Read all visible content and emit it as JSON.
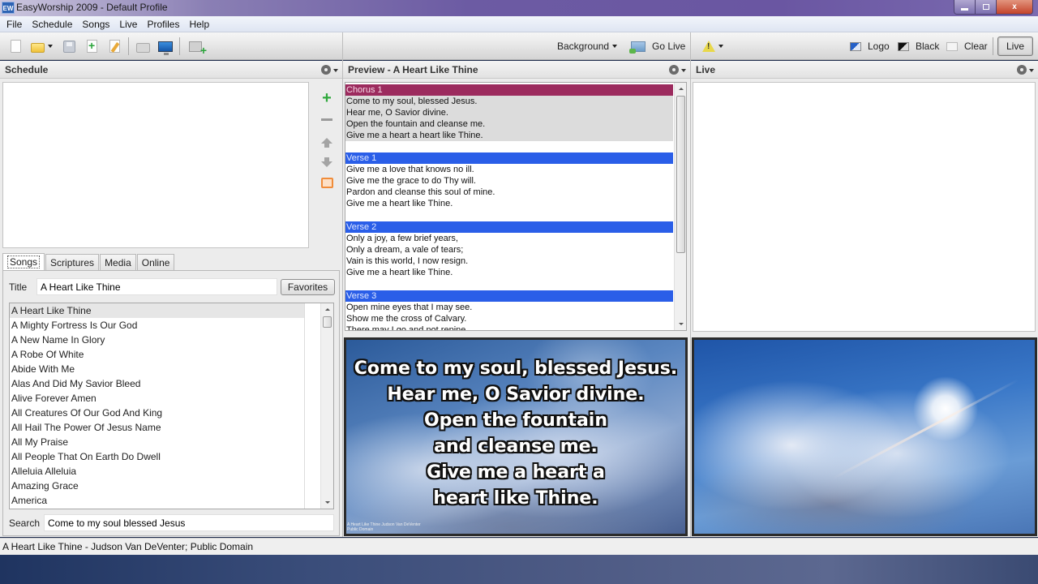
{
  "window": {
    "app_icon": "EW",
    "title": "EasyWorship 2009 - Default Profile",
    "controls": [
      "minimize",
      "maximize",
      "close"
    ],
    "close_glyph": "x"
  },
  "menu": [
    "File",
    "Schedule",
    "Songs",
    "Live",
    "Profiles",
    "Help"
  ],
  "toolbar": {
    "left_icons": [
      "new-schedule-icon",
      "open-folder-icon",
      "save-icon",
      "add-song-icon",
      "edit-song-icon",
      "print-icon",
      "monitor-icon",
      "add-to-schedule-icon"
    ],
    "background_label": "Background",
    "go_live_label": "Go Live",
    "logo_label": "Logo",
    "black_label": "Black",
    "clear_label": "Clear",
    "live_label": "Live"
  },
  "schedule": {
    "header": "Schedule",
    "items": []
  },
  "preview": {
    "header": "Preview - A Heart Like Thine",
    "sections": [
      {
        "label": "Chorus 1",
        "type": "chorus",
        "lines": [
          "Come to my soul, blessed Jesus.",
          "Hear me, O Savior divine.",
          "Open the fountain and cleanse me.",
          "Give me a heart a heart like Thine."
        ]
      },
      {
        "label": "Verse 1",
        "type": "verse",
        "lines": [
          "Give me a love that knows no ill.",
          "Give me the grace to do Thy will.",
          "Pardon and cleanse this soul of mine.",
          "Give me a heart like Thine."
        ]
      },
      {
        "label": "Verse 2",
        "type": "verse",
        "lines": [
          "Only a joy, a few brief years,",
          "Only a dream, a vale of tears;",
          "Vain is this world, I now resign.",
          "Give me a heart like Thine."
        ]
      },
      {
        "label": "Verse 3",
        "type": "verse",
        "lines": [
          "Open mine eyes that I may see.",
          "Show me the cross of Calvary.",
          "There may I go and not repine."
        ]
      }
    ],
    "slide_lines": [
      "Come to my soul, blessed Jesus.",
      "Hear me, O Savior divine.",
      "Open the fountain",
      "and cleanse me.",
      "Give me a heart a",
      "heart like Thine."
    ],
    "slide_footer_1": "A Heart Like Thine   Judson Van DeVenter",
    "slide_footer_2": "Public Domain"
  },
  "live": {
    "header": "Live",
    "items": []
  },
  "library": {
    "tabs": [
      "Songs",
      "Scriptures",
      "Media",
      "Online"
    ],
    "active_tab": "Songs",
    "title_label": "Title",
    "title_value": "A Heart Like Thine",
    "favorites_label": "Favorites",
    "songs": [
      "A Heart Like Thine",
      "A Mighty Fortress Is Our God",
      "A New Name In Glory",
      "A Robe Of White",
      "Abide With Me",
      "Alas And Did My Savior Bleed",
      "Alive Forever Amen",
      "All Creatures Of Our God And King",
      "All Hail The Power Of Jesus Name",
      "All My Praise",
      "All People That On Earth Do Dwell",
      "Alleluia Alleluia",
      "Amazing Grace",
      "America"
    ],
    "selected_song": "A Heart Like Thine",
    "search_label": "Search",
    "search_value": "Come to my soul blessed Jesus"
  },
  "status": "A Heart Like Thine - Judson Van DeVenter; Public Domain",
  "colors": {
    "chorus_header": "#9c2b5e",
    "verse_header": "#2a5ee8",
    "add_green": "#2fa83c"
  }
}
